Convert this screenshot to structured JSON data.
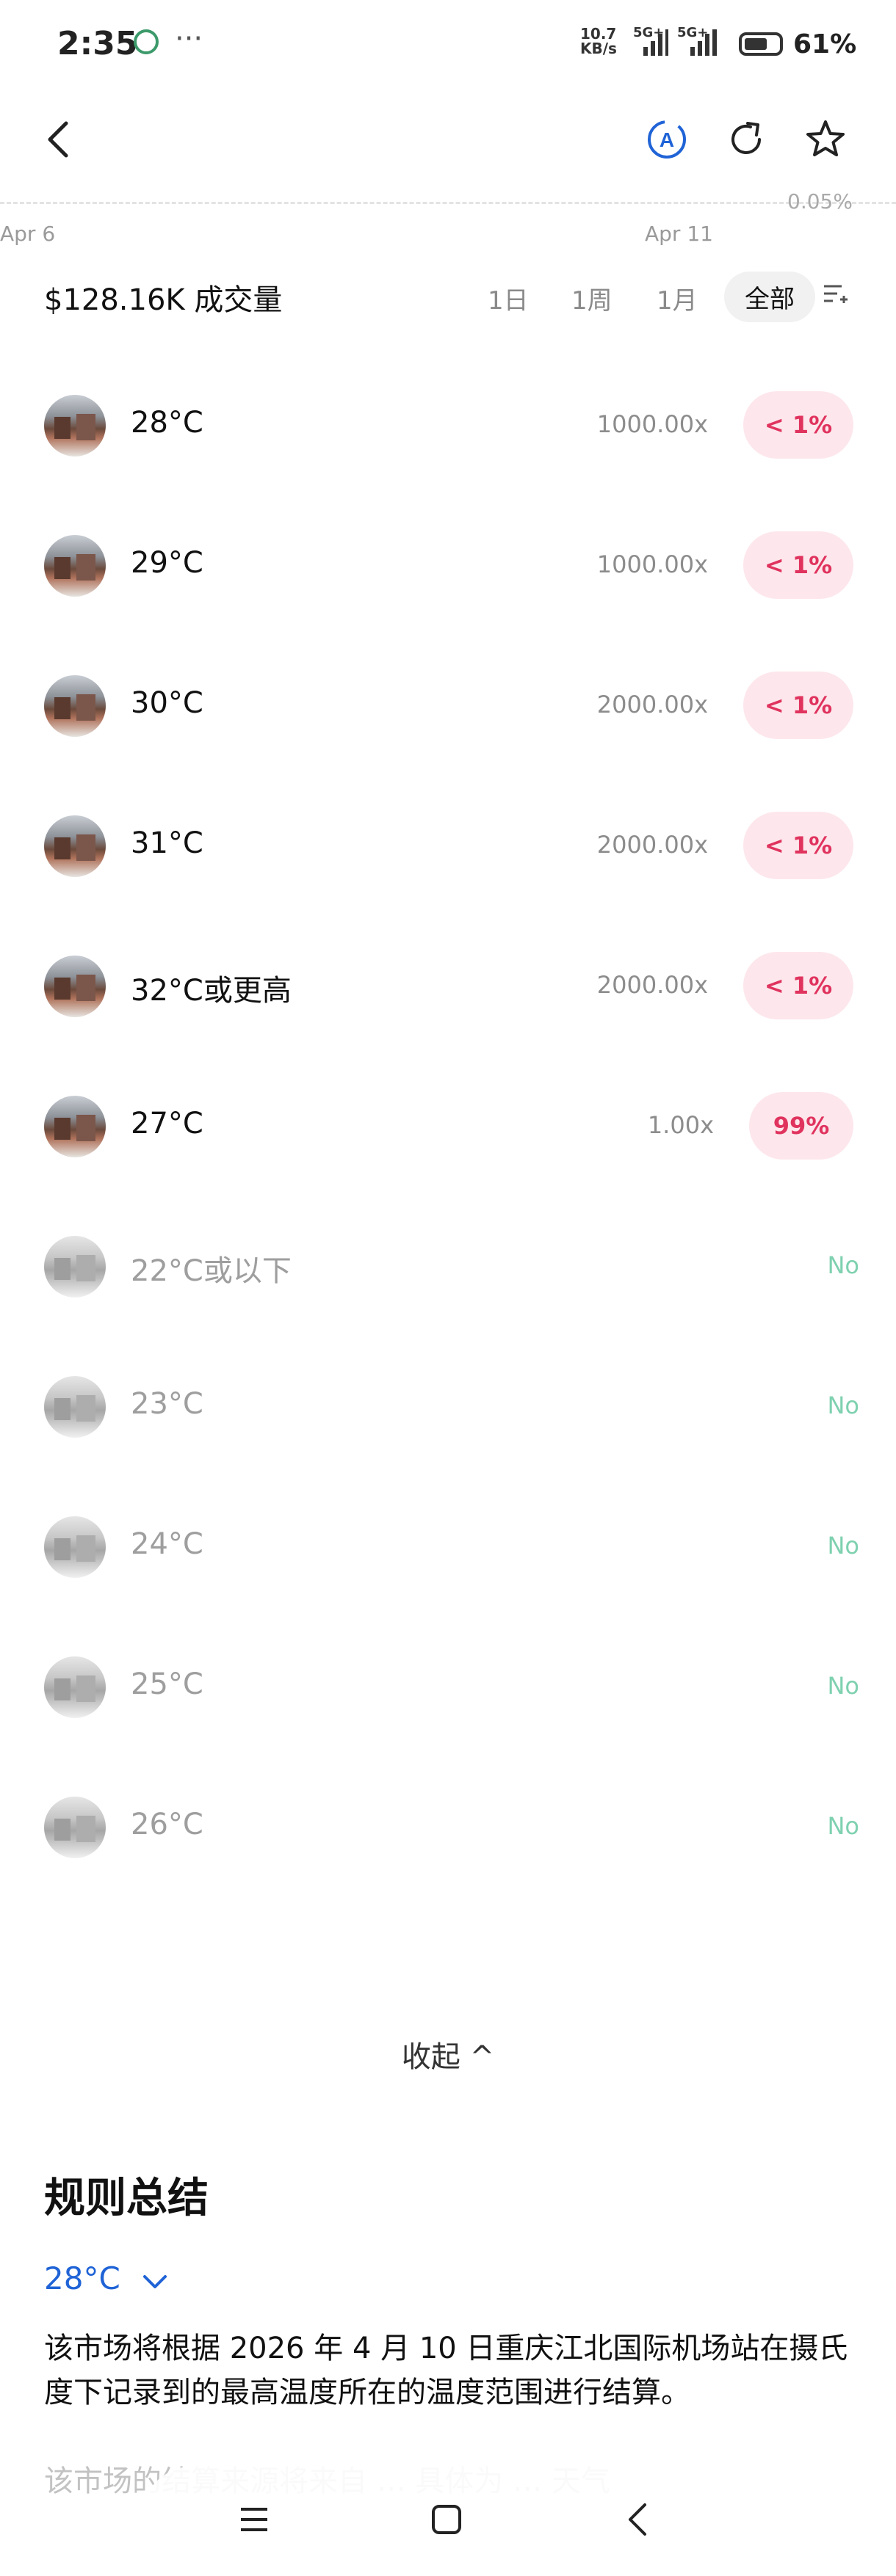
{
  "status_bar": {
    "time": "2:35",
    "speed": "10.7",
    "speed_unit": "KB/s",
    "net1": "5G+",
    "net2": "5G+",
    "battery": "61%"
  },
  "chart": {
    "top_right_pct": "0.05%",
    "date_left": "Apr 6",
    "date_right": "Apr 11"
  },
  "header": {
    "volume": "$128.16K 成交量",
    "tabs": [
      "1日",
      "1周",
      "1月",
      "全部"
    ],
    "active_tab": "全部"
  },
  "outcomes": [
    {
      "label": "28°C",
      "multiplier": "1000.00x",
      "chance": "< 1%",
      "resolved": false
    },
    {
      "label": "29°C",
      "multiplier": "1000.00x",
      "chance": "< 1%",
      "resolved": false
    },
    {
      "label": "30°C",
      "multiplier": "2000.00x",
      "chance": "< 1%",
      "resolved": false
    },
    {
      "label": "31°C",
      "multiplier": "2000.00x",
      "chance": "< 1%",
      "resolved": false
    },
    {
      "label": "32°C或更高",
      "multiplier": "2000.00x",
      "chance": "< 1%",
      "resolved": false
    },
    {
      "label": "27°C",
      "multiplier": "1.00x",
      "chance": "99%",
      "resolved": false
    },
    {
      "label": "22°C或以下",
      "result": "No",
      "resolved": true
    },
    {
      "label": "23°C",
      "result": "No",
      "resolved": true
    },
    {
      "label": "24°C",
      "result": "No",
      "resolved": true
    },
    {
      "label": "25°C",
      "result": "No",
      "resolved": true
    },
    {
      "label": "26°C",
      "result": "No",
      "resolved": true
    }
  ],
  "collapse_label": "收起 ^",
  "rules": {
    "title": "规则总结",
    "selected": "28°C",
    "text": "该市场将根据 2026 年 4 月 10 日重庆江北国际机场站在摄氏度下记录到的最高温度所在的温度范围进行结算。",
    "faded_text": "该市场的结算来源将来自 … 具体为 … 天气"
  },
  "colors": {
    "pill_bg": "#fde7ec",
    "pill_text": "#e0335e",
    "no_text": "#7fd1b0",
    "link_blue": "#1f63d6"
  }
}
